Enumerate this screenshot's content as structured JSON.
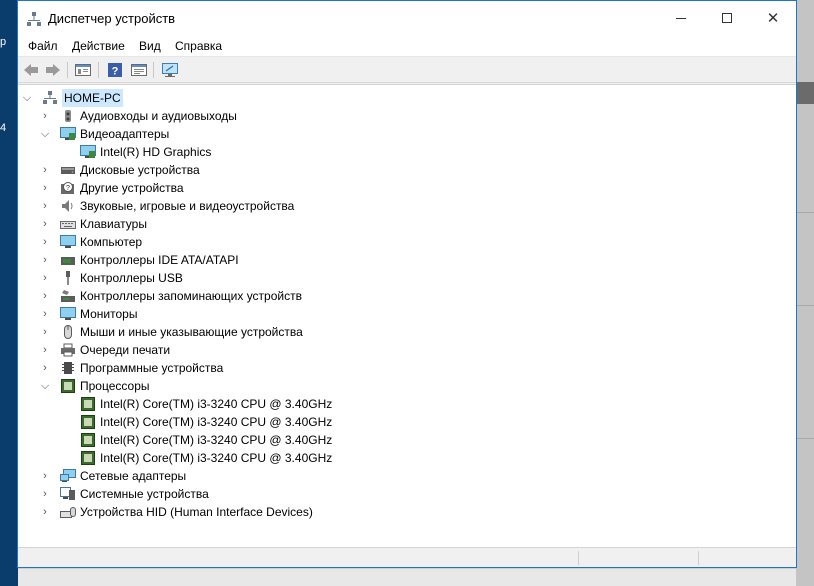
{
  "window": {
    "title": "Диспетчер устройств"
  },
  "desktop": {
    "left_text_1": "р",
    "left_text_2": "4"
  },
  "menu": [
    "Файл",
    "Действие",
    "Вид",
    "Справка"
  ],
  "toolbar": [
    "back-icon",
    "forward-icon",
    "show-hide-tree-icon",
    "help-icon",
    "properties-icon",
    "scan-hardware-icon"
  ],
  "tree": {
    "root": "HOME-PC",
    "categories": [
      {
        "label": "Аудиовходы и аудиовыходы",
        "icon": "audio-io-icon",
        "expanded": false
      },
      {
        "label": "Видеоадаптеры",
        "icon": "display-adapter-icon",
        "expanded": true,
        "children": [
          "Intel(R) HD Graphics"
        ]
      },
      {
        "label": "Дисковые устройства",
        "icon": "disk-drive-icon",
        "expanded": false
      },
      {
        "label": "Другие устройства",
        "icon": "other-devices-icon",
        "expanded": false
      },
      {
        "label": "Звуковые, игровые и видеоустройства",
        "icon": "sound-video-icon",
        "expanded": false
      },
      {
        "label": "Клавиатуры",
        "icon": "keyboard-icon",
        "expanded": false
      },
      {
        "label": "Компьютер",
        "icon": "computer-icon",
        "expanded": false
      },
      {
        "label": "Контроллеры IDE ATA/ATAPI",
        "icon": "ide-controller-icon",
        "expanded": false
      },
      {
        "label": "Контроллеры USB",
        "icon": "usb-icon",
        "expanded": false
      },
      {
        "label": "Контроллеры запоминающих устройств",
        "icon": "storage-controller-icon",
        "expanded": false
      },
      {
        "label": "Мониторы",
        "icon": "monitor-icon",
        "expanded": false
      },
      {
        "label": "Мыши и иные указывающие устройства",
        "icon": "mouse-icon",
        "expanded": false
      },
      {
        "label": "Очереди печати",
        "icon": "printer-icon",
        "expanded": false
      },
      {
        "label": "Программные устройства",
        "icon": "software-device-icon",
        "expanded": false
      },
      {
        "label": "Процессоры",
        "icon": "processor-icon",
        "expanded": true,
        "children": [
          "Intel(R) Core(TM) i3-3240 CPU @ 3.40GHz",
          "Intel(R) Core(TM) i3-3240 CPU @ 3.40GHz",
          "Intel(R) Core(TM) i3-3240 CPU @ 3.40GHz",
          "Intel(R) Core(TM) i3-3240 CPU @ 3.40GHz"
        ]
      },
      {
        "label": "Сетевые адаптеры",
        "icon": "network-adapter-icon",
        "expanded": false
      },
      {
        "label": "Системные устройства",
        "icon": "system-devices-icon",
        "expanded": false
      },
      {
        "label": "Устройства HID (Human Interface Devices)",
        "icon": "hid-icon",
        "expanded": false
      }
    ]
  }
}
